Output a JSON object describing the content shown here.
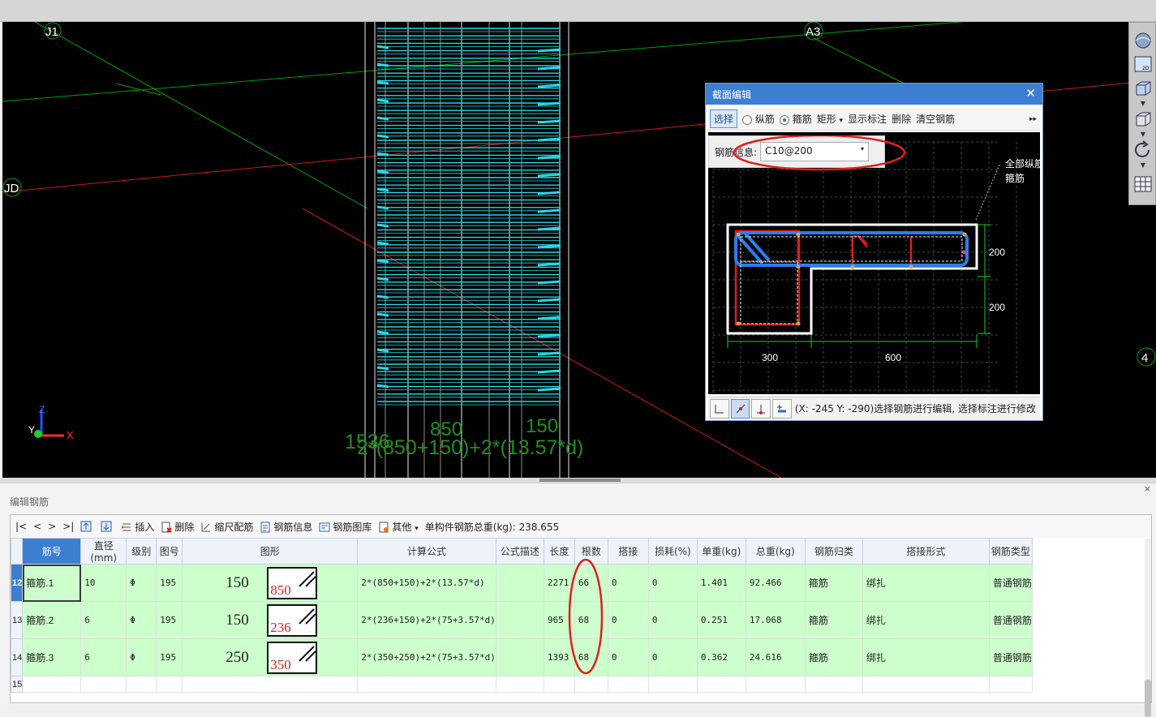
{
  "viewport": {
    "axis_labels": {
      "j1": "J1",
      "a3": "A3",
      "jd": "JD",
      "four": "4"
    },
    "dimension_texts": {
      "a": "150",
      "b": "850",
      "c": "2*(850+150)+2*(13.57*d)",
      "d": "1536"
    },
    "axis_gizmo": {
      "z": "Z",
      "y": "Y",
      "x": "X"
    },
    "colors": {
      "rebar": "#29d6e8",
      "grid_green": "#00a000",
      "grid_red": "#d01818"
    }
  },
  "section_dialog": {
    "title": "截面编辑",
    "close": "✕",
    "toolbar": {
      "select": "选择",
      "longitudinal": "纵筋",
      "stirrup": "箍筋",
      "shape": "矩形",
      "shape_caret": "▾",
      "show_marks": "显示标注",
      "delete": "删除",
      "clear": "清空钢筋",
      "more": "▸▸"
    },
    "info_label": "钢筋信息:",
    "info_value": "C10@200",
    "info_caret": "▾",
    "annotation": "全部纵筋\n箍筋",
    "annotation_line1": "全部纵筋",
    "annotation_line2": "箍筋",
    "dims": {
      "v1": "200",
      "v2": "200",
      "h1": "300",
      "h2": "600"
    },
    "status_text": "(X: -245 Y: -290)选择钢筋进行编辑, 选择标注进行修改"
  },
  "panel": {
    "title": "编辑钢筋",
    "close": "×",
    "toolbar": {
      "first": "|<",
      "prev": "<",
      "next": ">",
      "last": ">|",
      "insert": "插入",
      "delete": "删除",
      "scale_rebar": "缩尺配筋",
      "rebar_info": "钢筋信息",
      "rebar_library": "钢筋图库",
      "other": "其他",
      "other_caret": "▾",
      "total_weight": "单构件钢筋总重(kg): 238.655"
    },
    "columns": [
      "筋号",
      "直径(mm)",
      "级别",
      "图号",
      "图形",
      "计算公式",
      "公式描述",
      "长度",
      "根数",
      "搭接",
      "损耗(%)",
      "单重(kg)",
      "总重(kg)",
      "钢筋归类",
      "搭接形式",
      "钢筋类型"
    ],
    "rows": [
      {
        "num": "12",
        "name": "箍筋.1",
        "dia": "10",
        "grade": "Φ",
        "fig": "195",
        "shape_a": "150",
        "shape_b": "850",
        "formula": "2*(850+150)+2*(13.57*d)",
        "desc": "",
        "length": "2271",
        "count": "66",
        "lap": "0",
        "loss": "0",
        "unit_w": "1.401",
        "total_w": "92.466",
        "cat": "箍筋",
        "lap_form": "绑扎",
        "type": "普通钢筋"
      },
      {
        "num": "13",
        "name": "箍筋.2",
        "dia": "6",
        "grade": "Φ",
        "fig": "195",
        "shape_a": "150",
        "shape_b": "236",
        "formula": "2*(236+150)+2*(75+3.57*d)",
        "desc": "",
        "length": "965",
        "count": "68",
        "lap": "0",
        "loss": "0",
        "unit_w": "0.251",
        "total_w": "17.068",
        "cat": "箍筋",
        "lap_form": "绑扎",
        "type": "普通钢筋"
      },
      {
        "num": "14",
        "name": "箍筋.3",
        "dia": "6",
        "grade": "Φ",
        "fig": "195",
        "shape_a": "250",
        "shape_b": "350",
        "formula": "2*(350+250)+2*(75+3.57*d)",
        "desc": "",
        "length": "1393",
        "count": "68",
        "lap": "0",
        "loss": "0",
        "unit_w": "0.362",
        "total_w": "24.616",
        "cat": "箍筋",
        "lap_form": "绑扎",
        "type": "普通钢筋"
      }
    ],
    "empty_row_num": "15"
  }
}
